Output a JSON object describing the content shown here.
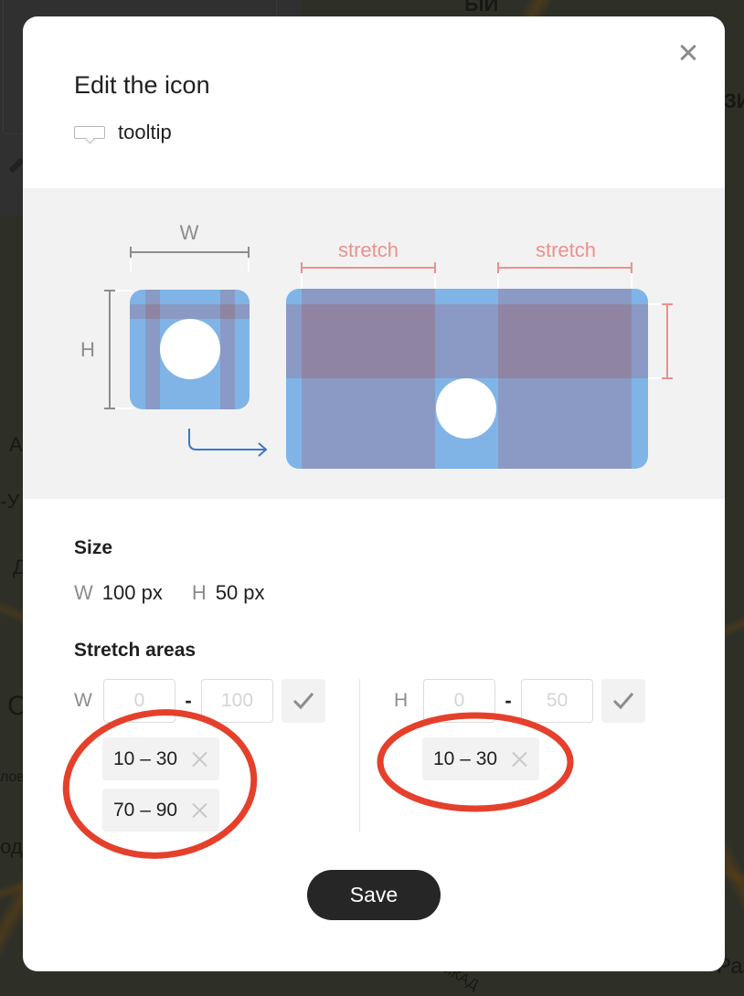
{
  "background": {
    "map_labels": [
      "ЫЙ",
      "ЗИТ",
      "А",
      "-У",
      "Д",
      "С",
      "лов",
      "од",
      "МКАД",
      "Раз"
    ]
  },
  "modal": {
    "title": "Edit the icon",
    "icon_type": {
      "icon": "tooltip-icon",
      "label": "tooltip"
    },
    "close_icon": "close-icon",
    "illustration": {
      "width_label": "W",
      "height_label": "H",
      "stretch_labels": [
        "stretch",
        "stretch"
      ],
      "colors": {
        "icon_fill": "#80b4e6",
        "stretch_overlay": "#8a9ac4",
        "stretch_intersection": "#8f85a3",
        "measure_gray": "#8c8c8c",
        "measure_red": "#e8928f",
        "arrow_blue": "#3a78c9"
      }
    },
    "size": {
      "title": "Size",
      "width_letter": "W",
      "width_value": "100 px",
      "height_letter": "H",
      "height_value": "50 px"
    },
    "stretch_areas": {
      "title": "Stretch areas",
      "width": {
        "letter": "W",
        "from_placeholder": "0",
        "to_placeholder": "100",
        "separator": "-",
        "confirm_icon": "check-icon",
        "chips": [
          {
            "label": "10 – 30"
          },
          {
            "label": "70 – 90"
          }
        ]
      },
      "height": {
        "letter": "H",
        "from_placeholder": "0",
        "to_placeholder": "50",
        "separator": "-",
        "confirm_icon": "check-icon",
        "chips": [
          {
            "label": "10 – 30"
          }
        ]
      }
    },
    "save_label": "Save"
  },
  "annotation_color": "#e5402b"
}
